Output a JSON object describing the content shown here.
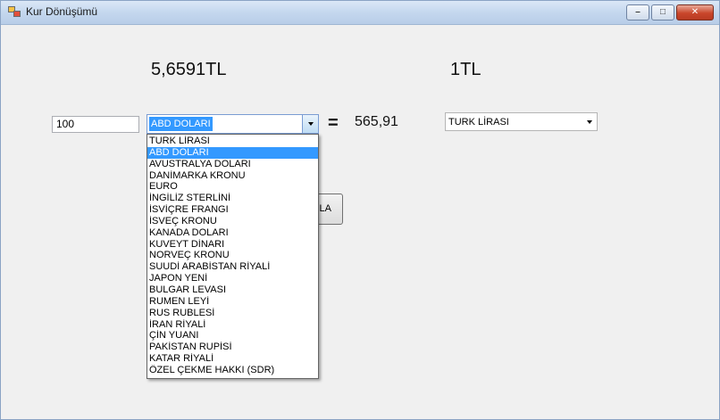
{
  "window": {
    "title": "Kur Dönüşümü",
    "caption_buttons": [
      "minimize",
      "maximize",
      "close"
    ]
  },
  "labels": {
    "from_rate": "5,6591TL",
    "to_rate": "1TL"
  },
  "amount_input": {
    "value": "100"
  },
  "from_currency": {
    "selected": "ABD DOLARI"
  },
  "equals_sign": "=",
  "result": "565,91",
  "to_currency": {
    "selected": "TURK LİRASI"
  },
  "convert_button": {
    "label_visible": "LA"
  },
  "dropdown": {
    "selected_index": 1,
    "options": [
      "TURK LİRASI",
      "ABD DOLARI",
      "AVUSTRALYA DOLARI",
      "DANİMARKA KRONU",
      "EURO",
      "İNGİLİZ STERLİNİ",
      "İSVİÇRE FRANGI",
      "İSVEÇ KRONU",
      "KANADA DOLARI",
      "KUVEYT DİNARI",
      "NORVEÇ KRONU",
      "SUUDİ ARABİSTAN RİYALİ",
      "JAPON YENİ",
      "BULGAR LEVASI",
      "RUMEN LEYİ",
      "RUS RUBLESİ",
      "İRAN RİYALİ",
      "ÇİN YUANI",
      "PAKİSTAN RUPİSİ",
      "KATAR RİYALİ",
      "ÖZEL ÇEKME HAKKI (SDR)"
    ]
  },
  "colors": {
    "selection": "#3399ff",
    "window_bg": "#f0f0f0",
    "close_button": "#c9462b"
  }
}
